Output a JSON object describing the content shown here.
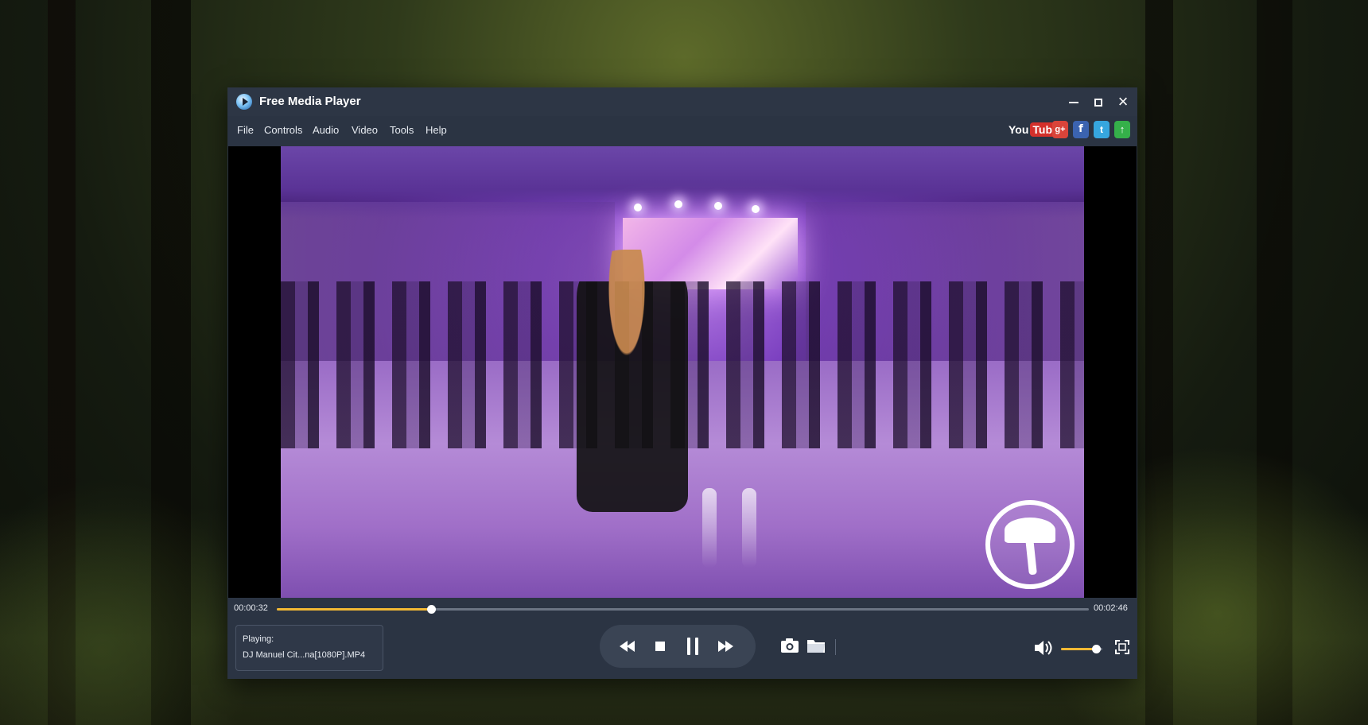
{
  "window": {
    "title": "Free Media Player",
    "controls": [
      "minimize-icon",
      "maximize-icon",
      "close-icon"
    ]
  },
  "menu": {
    "items": [
      "File",
      "Controls",
      "Audio",
      "Video",
      "Tools",
      "Help"
    ]
  },
  "social": {
    "youtube_you": "You",
    "youtube_tube": "Tube",
    "icons": [
      "youtube-icon",
      "google-plus-icon",
      "facebook-icon",
      "twitter-icon",
      "upload-icon"
    ],
    "gplus_glyph": "g+",
    "facebook_glyph": "f",
    "twitter_glyph": "t",
    "upload_glyph": "↑"
  },
  "playback": {
    "current_time": "00:00:32",
    "total_time": "00:02:46",
    "progress_fraction": 0.19,
    "volume_fraction": 0.85
  },
  "now_playing": {
    "label": "Playing:",
    "file": "DJ Manuel Cit...na[1080P].MP4"
  },
  "colors": {
    "accent": "#f3b934",
    "window_bg": "#2b3443",
    "titlebar_bg": "#2d3645"
  },
  "icons": {
    "transport": [
      "rewind-icon",
      "stop-icon",
      "pause-icon",
      "fast-forward-icon"
    ],
    "tools": [
      "snapshot-camera-icon",
      "open-folder-icon"
    ],
    "right": [
      "volume-icon",
      "fullscreen-icon"
    ]
  }
}
